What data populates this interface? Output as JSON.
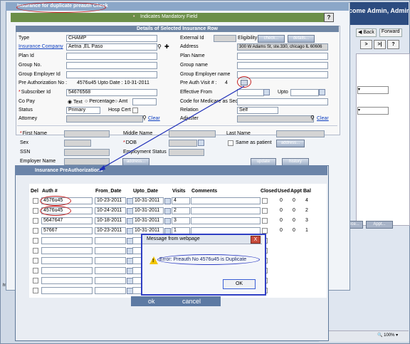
{
  "background_app": {
    "welcome": "come Admin, Admin",
    "nav": {
      "back": "Back",
      "forward": "Forward"
    },
    "arrows": [
      ">",
      ">|",
      "?"
    ],
    "buttons": [
      "vice...",
      "Appt..."
    ],
    "statusbar_left": "https:",
    "zoom": "100%"
  },
  "modal": {
    "title": "Insurance for duplicate preauth Check",
    "mandatory_note": "Indicates Mandatory Field",
    "help": "?",
    "details_header": "Details of Selected Insurance Row",
    "left_fields": [
      {
        "label": "Type",
        "value": "CHAMP"
      },
      {
        "label": "Insurance Company",
        "value": "Aetna ,EL Paso"
      },
      {
        "label": "Plan Id",
        "value": ""
      },
      {
        "label": "Group No.",
        "value": ""
      },
      {
        "label": "Group Employer Id",
        "value": ""
      },
      {
        "label": "Pre Authorization No :",
        "value": "4576u45  Upto Date :  10-31-2011"
      },
      {
        "label": "Subscriber Id",
        "value": "54676568"
      },
      {
        "label": "Co Pay",
        "value": ""
      },
      {
        "label": "Status",
        "value": "Primary"
      },
      {
        "label": "Attorney",
        "value": ""
      }
    ],
    "copay_options": [
      "Text",
      "Percentage",
      "Amt"
    ],
    "hosp_cert": "Hosp Cert",
    "clear": "Clear",
    "right_fields": [
      {
        "label": "External Id",
        "value": ""
      },
      {
        "label": "Address",
        "value": "300 W Adams St, ste.330, chicago IL 60606"
      },
      {
        "label": "Plan Name",
        "value": ""
      },
      {
        "label": "Group name",
        "value": ""
      },
      {
        "label": "Group Employer name",
        "value": ""
      },
      {
        "label": "Pre Auth Visit # :",
        "value": "4"
      },
      {
        "label": "Effective From",
        "value": ""
      },
      {
        "label": "Code for Medicare as Sec",
        "value": ""
      },
      {
        "label": "Relation",
        "value": "Self"
      },
      {
        "label": "Adjuster",
        "value": ""
      }
    ],
    "eligibility": "Eligibility",
    "check_btn": "check...",
    "details_btn": "details...",
    "upto": "Upto",
    "lower": {
      "first_name": "First Name",
      "middle_name": "Middle Name",
      "last_name": "Last Name",
      "sex": "Sex",
      "dob": "DOB",
      "same_as_patient": "Same as patient",
      "address_btn": "address...",
      "ssn": "SSN",
      "employment_status": "Employment Status",
      "employer_name": "Employer Name",
      "address_btn2": "address...",
      "update_btn": "update",
      "history_btn": "history"
    }
  },
  "preauth": {
    "title": "Insurance PreAuthorizations",
    "columns": [
      "Del",
      "Auth #",
      "From_Date",
      "Upto_Date",
      "Visits",
      "Comments",
      "Closed",
      "Used",
      "Appt",
      "Bal"
    ],
    "rows": [
      {
        "auth": "4576u45",
        "from": "10-23-2011",
        "upto": "10-31-2011",
        "visits": "4",
        "used": "0",
        "appt": "0",
        "bal": "4"
      },
      {
        "auth": "4576u45",
        "from": "10-24-2011",
        "upto": "10-31-2011",
        "visits": "2",
        "used": "0",
        "appt": "0",
        "bal": "2"
      },
      {
        "auth": "5647647",
        "from": "10-18-2011",
        "upto": "10-31-2011",
        "visits": "3",
        "used": "0",
        "appt": "0",
        "bal": "3"
      },
      {
        "auth": "57667",
        "from": "10-23-2011",
        "upto": "10-31-2011",
        "visits": "1",
        "used": "0",
        "appt": "0",
        "bal": "1"
      }
    ],
    "ok": "ok",
    "cancel": "cancel"
  },
  "dialog": {
    "title": "Message from webpage",
    "message": "Error: Preauth No 4576u45 is Duplicate",
    "ok": "OK",
    "close": "X"
  }
}
